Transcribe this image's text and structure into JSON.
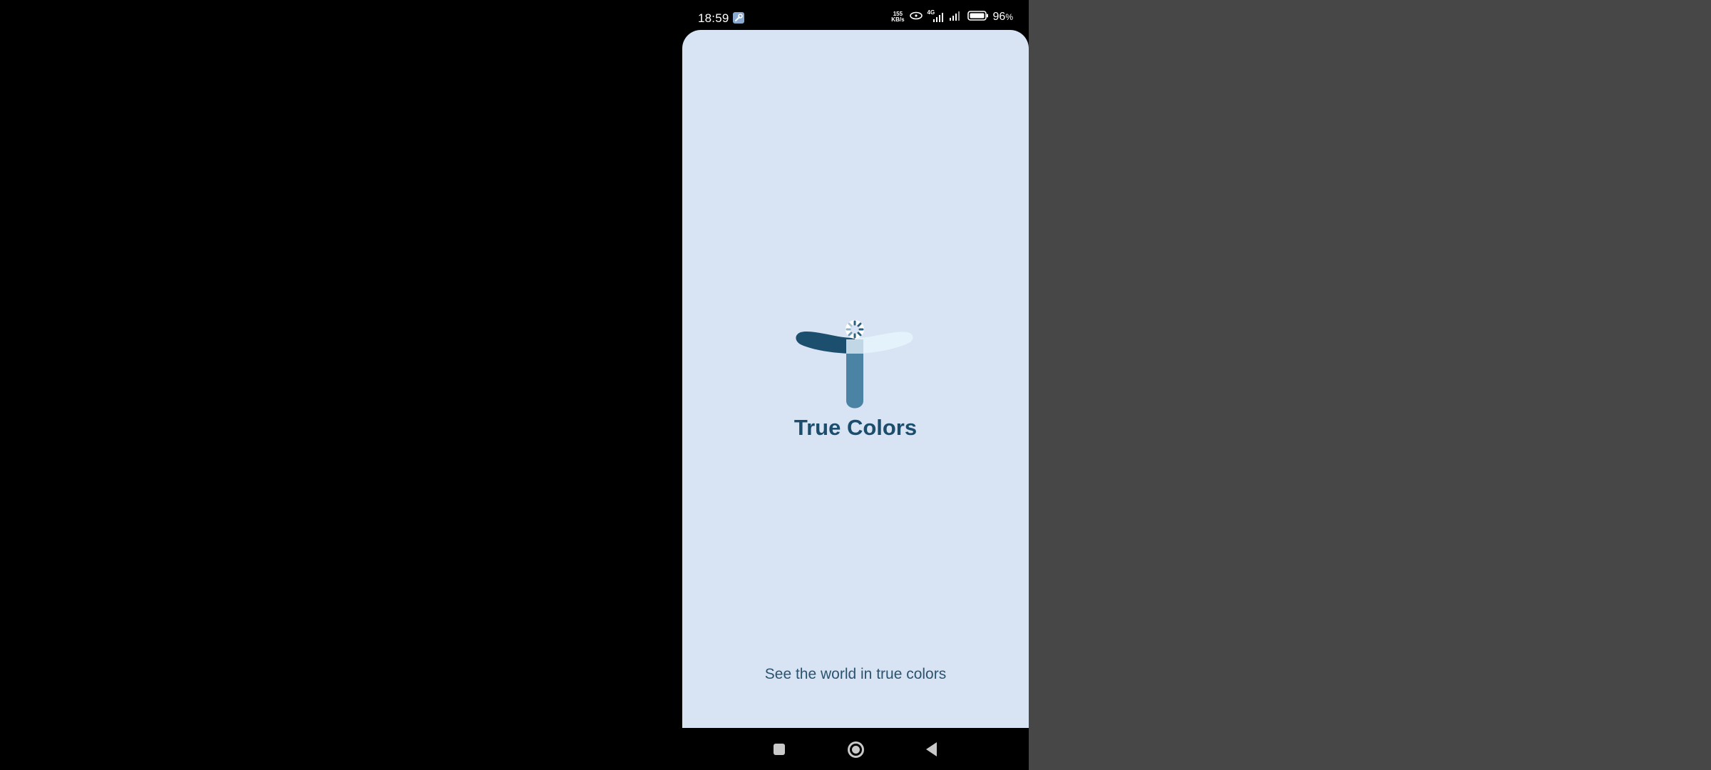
{
  "status_bar": {
    "time": "18:59",
    "net_speed_value": "155",
    "net_speed_unit": "KB/s",
    "network_type": "4G",
    "battery_percent": "96",
    "battery_unit": "%"
  },
  "app": {
    "title": "True Colors",
    "tagline": "See the world in true colors",
    "background_color": "#d8e3f3",
    "text_color": "#1b4d6d",
    "logo_colors": {
      "left_arm": "#1c4e6e",
      "right_arm": "#e4f2fb",
      "stem": "#4a83a4"
    }
  },
  "navigation": {
    "recents_icon": "square-icon",
    "home_icon": "circle-icon",
    "back_icon": "triangle-back-icon"
  },
  "surroundings": {
    "left_color": "#000000",
    "right_color": "#474747"
  }
}
